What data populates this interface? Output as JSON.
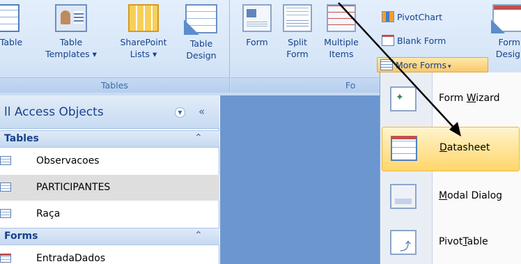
{
  "ribbon": {
    "tables_group": {
      "label": "Tables",
      "buttons": [
        {
          "label": "Table",
          "icon": "table-icon"
        },
        {
          "label": "Table\nTemplates ▾",
          "icon": "table-templates-icon"
        },
        {
          "label": "SharePoint\nLists ▾",
          "icon": "sharepoint-lists-icon"
        },
        {
          "label": "Table\nDesign",
          "icon": "table-design-icon"
        }
      ]
    },
    "forms_group": {
      "label": "Fo",
      "buttons": [
        {
          "label": "Form",
          "icon": "form-icon"
        },
        {
          "label": "Split\nForm",
          "icon": "split-form-icon"
        },
        {
          "label": "Multiple\nItems",
          "icon": "multiple-items-icon"
        },
        {
          "label": "Form\nDesig",
          "icon": "form-design-icon"
        }
      ],
      "pivotchart": "PivotChart",
      "blank_form": "Blank Form",
      "more_forms": "More Forms"
    }
  },
  "nav": {
    "title": "ll Access Objects",
    "sections": [
      {
        "title": "Tables",
        "items": [
          "Observacoes",
          "PARTICIPANTES",
          "Raça"
        ]
      },
      {
        "title": "Forms",
        "items": [
          "EntradaDados"
        ]
      }
    ]
  },
  "menu": {
    "items": [
      {
        "pre": "Form ",
        "key": "W",
        "post": "izard",
        "icon": "form-wizard-icon"
      },
      {
        "pre": "",
        "key": "D",
        "post": "atasheet",
        "icon": "datasheet-icon"
      },
      {
        "pre": "",
        "key": "M",
        "post": "odal Dialog",
        "icon": "modal-dialog-icon"
      },
      {
        "pre": "Pivot",
        "key": "T",
        "post": "able",
        "icon": "pivottable-icon"
      }
    ]
  },
  "colors": {
    "accent_text": "#15428b",
    "workspace": "#6b96cf",
    "highlight": "#ffd66a"
  }
}
